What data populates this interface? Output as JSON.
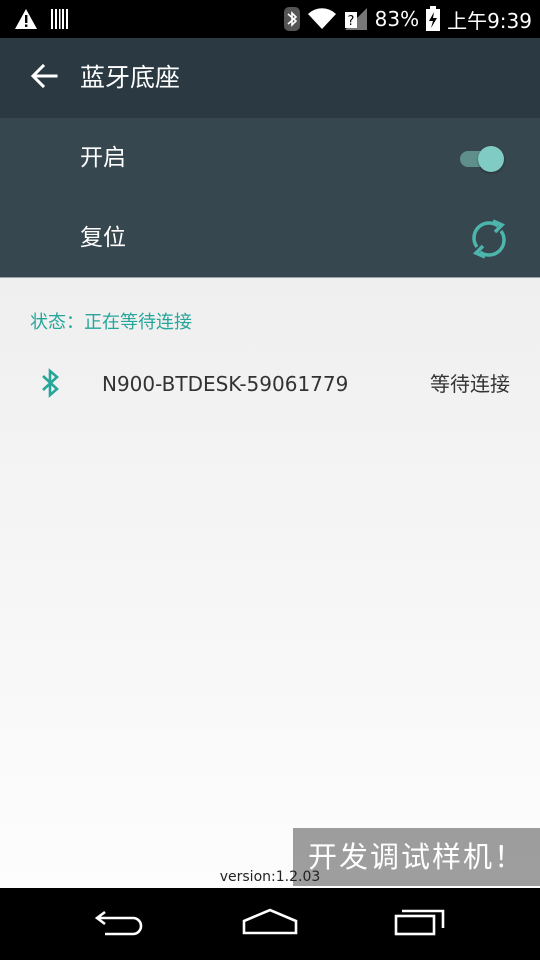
{
  "status_bar": {
    "battery_percent": "83%",
    "time": "上午9:39",
    "icons": [
      "warning-icon",
      "barcode-icon",
      "bluetooth-icon",
      "wifi-icon",
      "no-sim-icon",
      "battery-charging-icon"
    ]
  },
  "app_bar": {
    "title": "蓝牙底座",
    "back_icon": "arrow-left-icon"
  },
  "settings": {
    "enable_label": "开启",
    "enable_on": true,
    "reset_label": "复位",
    "reset_icon": "refresh-icon"
  },
  "main": {
    "status_text": "状态：正在等待连接",
    "devices": [
      {
        "name": "N900-BTDESK-59061779",
        "state": "等待连接",
        "icon": "bluetooth-icon"
      }
    ],
    "version": "version:1.2.03",
    "watermark": "开发调试样机！"
  },
  "nav_bar": {
    "icons": [
      "back-icon",
      "home-icon",
      "recents-icon"
    ]
  },
  "colors": {
    "app_bar": "#2b3a42",
    "settings_bg": "#37474f",
    "accent": "#26a69a",
    "toggle_thumb": "#80cbc4"
  }
}
